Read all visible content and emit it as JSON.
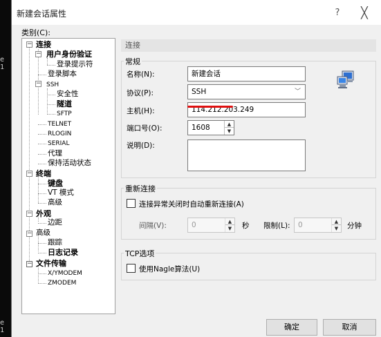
{
  "terminal": {
    "glyph_1": "e  1",
    "glyph_2": "e  1"
  },
  "dialog": {
    "title": "新建会话属性",
    "help": "?",
    "close": "╳",
    "category_label": "类别(C):"
  },
  "tree": [
    {
      "label": "连接",
      "bold": true
    },
    {
      "label": "用户身份验证",
      "bold": true
    },
    {
      "label": "登录提示符",
      "bold": false
    },
    {
      "label": "登录脚本",
      "bold": false
    },
    {
      "label": "SSH",
      "bold": false
    },
    {
      "label": "安全性",
      "bold": false
    },
    {
      "label": "隧道",
      "bold": true
    },
    {
      "label": "SFTP",
      "bold": false
    },
    {
      "label": "TELNET",
      "bold": false
    },
    {
      "label": "RLOGIN",
      "bold": false
    },
    {
      "label": "SERIAL",
      "bold": false
    },
    {
      "label": "代理",
      "bold": false
    },
    {
      "label": "保持活动状态",
      "bold": false
    },
    {
      "label": "终端",
      "bold": true
    },
    {
      "label": "键盘",
      "bold": true
    },
    {
      "label": "VT 模式",
      "bold": false
    },
    {
      "label": "高级",
      "bold": false
    },
    {
      "label": "外观",
      "bold": true
    },
    {
      "label": "边距",
      "bold": false
    },
    {
      "label": "高级",
      "bold": false
    },
    {
      "label": "跟踪",
      "bold": false
    },
    {
      "label": "日志记录",
      "bold": true
    },
    {
      "label": "文件传输",
      "bold": true
    },
    {
      "label": "X/YMODEM",
      "bold": false
    },
    {
      "label": "ZMODEM",
      "bold": false
    }
  ],
  "section_title": "连接",
  "general": {
    "caption": "常规",
    "name_label": "名称(N):",
    "name_value": "新建会话",
    "protocol_label": "协议(P):",
    "protocol_value": "SSH",
    "host_label": "主机(H):",
    "host_value": "114.212.203.249",
    "port_label": "端口号(O):",
    "port_value": "1608",
    "desc_label": "说明(D):",
    "desc_value": ""
  },
  "reconnect": {
    "caption": "重新连接",
    "checkbox_label": "连接异常关闭时自动重新连接(A)",
    "interval_label": "间隔(V):",
    "interval_value": "0",
    "interval_unit": "秒",
    "limit_label": "限制(L):",
    "limit_value": "0",
    "limit_unit": "分钟"
  },
  "tcp": {
    "caption": "TCP选项",
    "nagle_label": "使用Nagle算法(U)"
  },
  "buttons": {
    "ok": "确定",
    "cancel": "取消"
  }
}
